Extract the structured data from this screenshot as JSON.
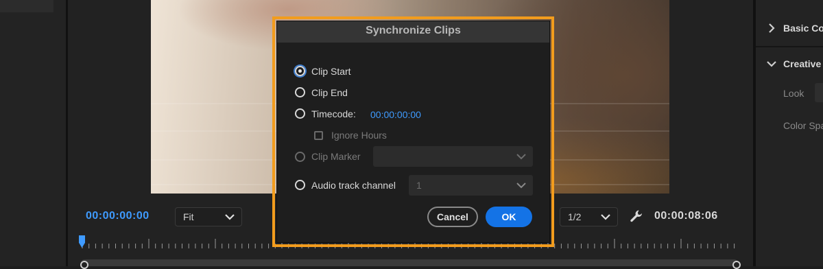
{
  "right_panel": {
    "basic_correction_label": "Basic Cor",
    "creative_label": "Creative",
    "look_label": "Look",
    "color_space_label": "Color Spa"
  },
  "program_monitor": {
    "timecode_current": "00:00:00:00",
    "zoom_value": "Fit",
    "resolution_value": "1/2",
    "timecode_duration": "00:00:08:06"
  },
  "dialog": {
    "title": "Synchronize Clips",
    "options": [
      {
        "label": "Clip Start",
        "selected": true,
        "enabled": true
      },
      {
        "label": "Clip End",
        "selected": false,
        "enabled": true
      },
      {
        "label": "Timecode:",
        "selected": false,
        "enabled": true,
        "value": "00:00:00:00"
      },
      {
        "label": "Clip Marker",
        "selected": false,
        "enabled": false,
        "dropdown_value": ""
      },
      {
        "label": "Audio track channel",
        "selected": false,
        "enabled": true,
        "dropdown_value": "1"
      }
    ],
    "ignore_hours_label": "Ignore Hours",
    "ignore_hours_checked": false,
    "cancel_label": "Cancel",
    "ok_label": "OK"
  },
  "colors": {
    "accent_blue": "#3f9bff",
    "highlight_orange": "#f29c1d",
    "ok_button": "#1473e6"
  }
}
